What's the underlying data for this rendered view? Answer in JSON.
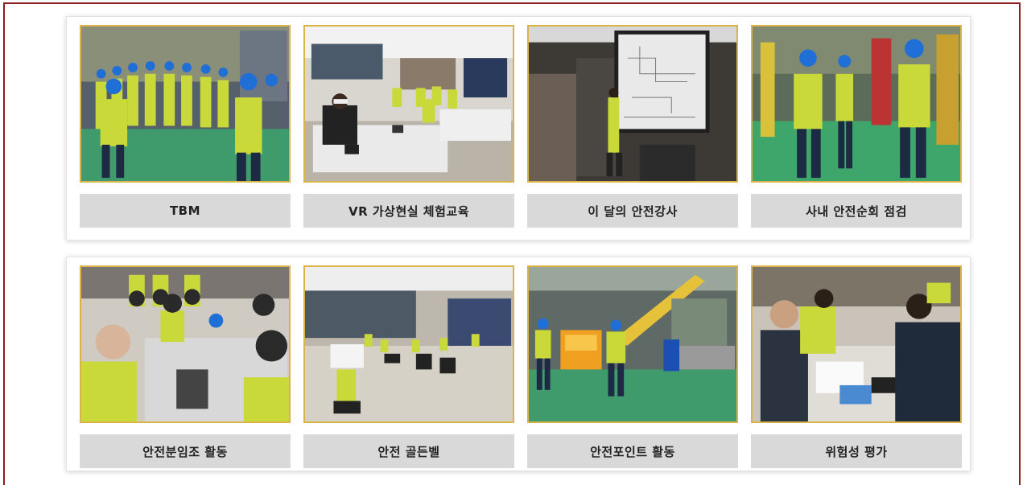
{
  "top_row": [
    {
      "caption": "TBM",
      "photo": "tbm-meeting-photo"
    },
    {
      "caption": "VR 가상현실 체험교육",
      "photo": "vr-training-photo"
    },
    {
      "caption": "이 달의 안전강사",
      "photo": "safety-lecture-photo"
    },
    {
      "caption": "사내 안전순회 점검",
      "photo": "safety-patrol-photo"
    }
  ],
  "bottom_row": [
    {
      "caption": "안전분임조 활동",
      "photo": "safety-group-photo"
    },
    {
      "caption": "안전 골든벨",
      "photo": "safety-golden-bell-photo"
    },
    {
      "caption": "안전포인트 활동",
      "photo": "safety-point-photo"
    },
    {
      "caption": "위험성 평가",
      "photo": "risk-assessment-photo"
    }
  ],
  "colors": {
    "frame": "#8b1d1d",
    "photo_border": "#d9b44a",
    "caption_bg": "#d9d9d9"
  }
}
